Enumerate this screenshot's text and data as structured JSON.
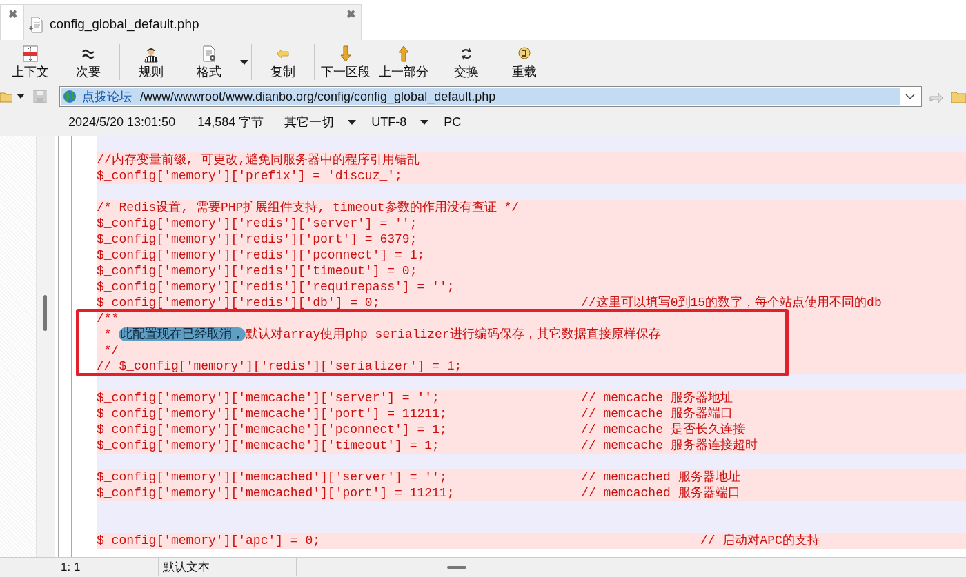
{
  "tabs": [
    {
      "close": "✖",
      "selected": false
    },
    {
      "label": "config_global_default.php",
      "close": "✖",
      "selected": true
    }
  ],
  "toolbar": [
    {
      "kind": "button",
      "label": "上下文"
    },
    {
      "kind": "button",
      "label": "次要"
    },
    {
      "kind": "separator"
    },
    {
      "kind": "button",
      "label": "规则"
    },
    {
      "kind": "button",
      "label": "格式",
      "has_menu": true
    },
    {
      "kind": "separator"
    },
    {
      "kind": "button",
      "label": "复制"
    },
    {
      "kind": "separator"
    },
    {
      "kind": "button",
      "label": "下一区段"
    },
    {
      "kind": "button",
      "label": "上一部分"
    },
    {
      "kind": "separator"
    },
    {
      "kind": "button",
      "label": "交换"
    },
    {
      "kind": "button",
      "label": "重载"
    }
  ],
  "address": {
    "site": "点拨论坛",
    "path": "/www/wwwroot/www.dianbo.org/config/config_global_default.php",
    "selected": true
  },
  "info": {
    "date": "2024/5/20 13:01:50",
    "size": "14,584 字节",
    "filter": "其它一切",
    "encoding": "UTF-8",
    "line_endings": "PC"
  },
  "lines": [
    {
      "kind": "blank"
    },
    {
      "kind": "code",
      "text": "//内存变量前缀, 可更改,避免同服务器中的程序引用错乱"
    },
    {
      "kind": "code",
      "text": "$_config['memory']['prefix'] = 'discuz_';"
    },
    {
      "kind": "blank"
    },
    {
      "kind": "code",
      "text": "/* Redis设置, 需要PHP扩展组件支持, timeout参数的作用没有查证 */"
    },
    {
      "kind": "code",
      "text": "$_config['memory']['redis']['server'] = '';"
    },
    {
      "kind": "code",
      "text": "$_config['memory']['redis']['port'] = 6379;"
    },
    {
      "kind": "code",
      "text": "$_config['memory']['redis']['pconnect'] = 1;"
    },
    {
      "kind": "code",
      "text": "$_config['memory']['redis']['timeout'] = 0;"
    },
    {
      "kind": "code",
      "text": "$_config['memory']['redis']['requirepass'] = '';"
    },
    {
      "kind": "code",
      "text": "$_config['memory']['redis']['db'] = 0;",
      "comment": "//这里可以填写0到15的数字，每个站点使用不同的db"
    },
    {
      "kind": "framed",
      "lines": [
        {
          "kind": "code",
          "text": "/**"
        },
        {
          "kind": "code",
          "text": " * ",
          "highlight": "此配置现在已经取消，",
          "after": "默认对array使用php serializer进行编码保存，其它数据直接原样保存"
        },
        {
          "kind": "code",
          "text": " */"
        },
        {
          "kind": "code",
          "text": "// $_config['memory']['redis']['serializer'] = 1;"
        }
      ]
    },
    {
      "kind": "blank"
    },
    {
      "kind": "code",
      "text": "$_config['memory']['memcache']['server'] = '';",
      "comment": "// memcache 服务器地址"
    },
    {
      "kind": "code",
      "text": "$_config['memory']['memcache']['port'] = 11211;",
      "comment": "// memcache 服务器端口"
    },
    {
      "kind": "code",
      "text": "$_config['memory']['memcache']['pconnect'] = 1;",
      "comment": "// memcache 是否长久连接"
    },
    {
      "kind": "code",
      "text": "$_config['memory']['memcache']['timeout'] = 1;",
      "comment": "// memcache 服务器连接超时"
    },
    {
      "kind": "blank"
    },
    {
      "kind": "code",
      "text": "$_config['memory']['memcached']['server'] = '';",
      "comment": "// memcached 服务器地址"
    },
    {
      "kind": "code",
      "text": "$_config['memory']['memcached']['port'] = 11211;",
      "comment": "// memcached 服务器端口"
    },
    {
      "kind": "blank"
    },
    {
      "kind": "blank"
    },
    {
      "kind": "code",
      "text": "$_config['memory']['apc'] = 0;",
      "comment": "// 启动对APC的支持",
      "comment_far": true
    }
  ],
  "status_bar": {
    "position": "1: 1",
    "mode": "默认文本"
  }
}
